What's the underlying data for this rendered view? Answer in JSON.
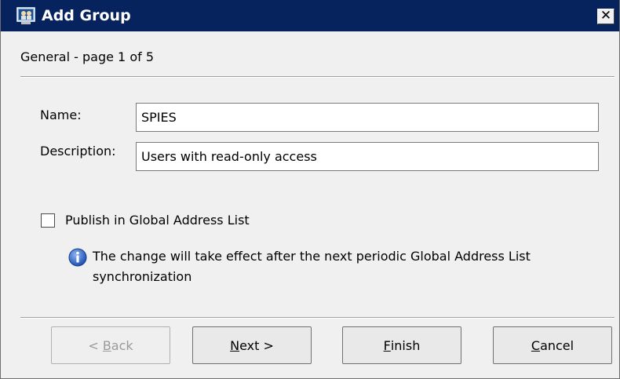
{
  "window": {
    "title": "Add Group",
    "close_glyph": "✕",
    "title_icon": "group-window-icon"
  },
  "page_heading": "General - page 1 of 5",
  "form": {
    "name_label": "Name:",
    "name_value": "SPIES",
    "description_label": "Description:",
    "description_value": "Users with read-only access"
  },
  "publish": {
    "checked": false,
    "label": "Publish in Global Address List",
    "info_icon": "info-icon",
    "info_line1": "The change will take effect after the next periodic Global Address List",
    "info_line2": "synchronization"
  },
  "buttons": {
    "back_prefix": "< ",
    "back_key": "B",
    "back_rest": "ack",
    "next_key": "N",
    "next_rest": "ext >",
    "finish_key": "F",
    "finish_rest": "inish",
    "cancel_key": "C",
    "cancel_rest": "ancel"
  },
  "colors": {
    "titlebar": "#07235e",
    "dialog_bg": "#f0f0f0"
  }
}
